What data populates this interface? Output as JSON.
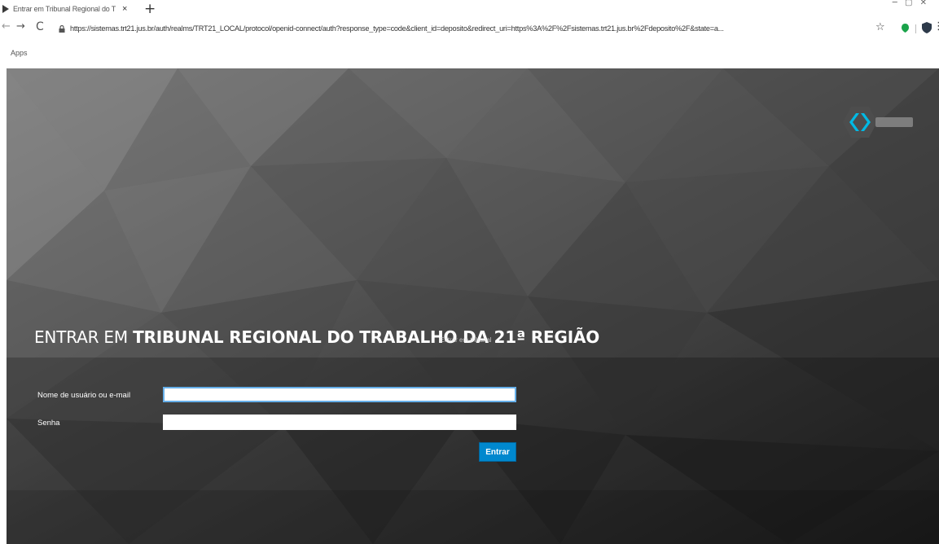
{
  "browser": {
    "tab_title": "Entrar em Tribunal Regional do T",
    "tab_close": "×",
    "new_tab": "+",
    "window_controls": "─ ▢ ✕",
    "back": "←",
    "forward": "→",
    "reload": "C",
    "url": "https://sistemas.trt21.jus.br/auth/realms/TRT21_LOCAL/protocol/openid-connect/auth?response_type=code&client_id=deposito&redirect_uri=https%3A%2F%2Fsistemas.trt21.jus.br%2Fdeposito%2F&state=a...",
    "bookmark_star": "☆",
    "menu": "⋮",
    "bookmarks": {
      "apps_label": "Apps"
    }
  },
  "page": {
    "heading_prefix": "ENTRAR EM",
    "realm_name": "TRIBUNAL REGIONAL DO TRABALHO DA 21ª REGIÃO",
    "ghost_text": "Entrar em tribunal",
    "form": {
      "username_label": "Nome de usuário ou e-mail",
      "username_value": "",
      "password_label": "Senha",
      "password_value": "",
      "submit_label": "Entrar"
    }
  },
  "colors": {
    "primary_button": "#0088ce",
    "background": "#3d3d3d",
    "brand_accent": "#00b9e4"
  },
  "icons": [
    "favicon-icon",
    "lock-icon",
    "star-icon",
    "extension-green-icon",
    "extension-shield-icon",
    "menu-icon",
    "keycloak-logo-icon"
  ]
}
